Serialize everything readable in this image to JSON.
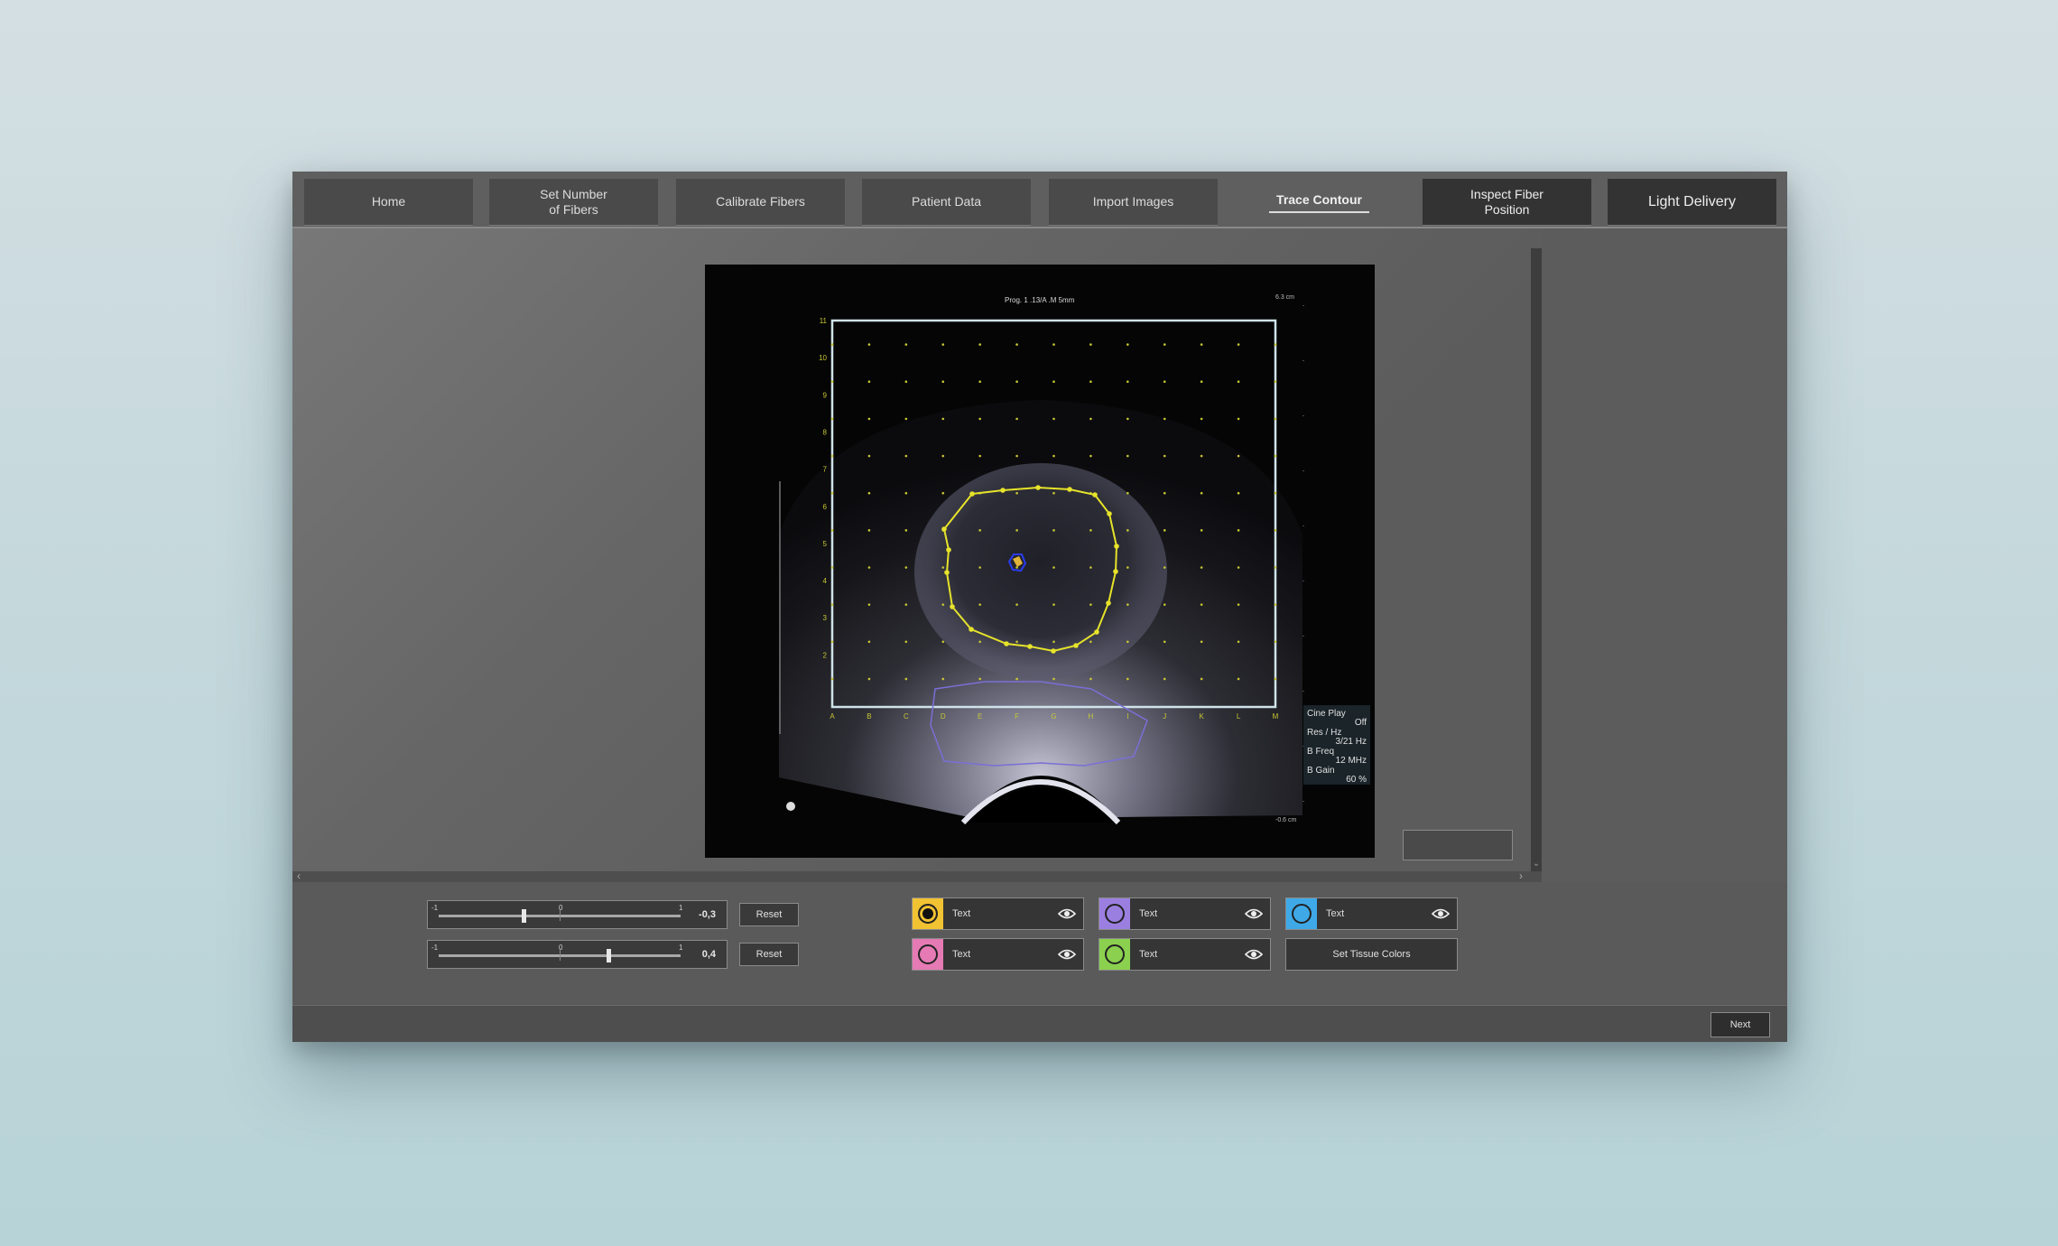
{
  "tabs": [
    {
      "label": "Home",
      "style": "normal"
    },
    {
      "label": "Set Number\nof Fibers",
      "style": "normal"
    },
    {
      "label": "Calibrate Fibers",
      "style": "normal"
    },
    {
      "label": "Patient Data",
      "style": "normal"
    },
    {
      "label": "Import Images",
      "style": "normal"
    },
    {
      "label": "Trace Contour",
      "style": "active"
    },
    {
      "label": "Inspect Fiber\nPosition",
      "style": "dark"
    },
    {
      "label": "Light Delivery",
      "style": "dark"
    }
  ],
  "image": {
    "header_text": "Prog. 1 .13/A .M 5mm",
    "depth_top": "6.3 cm",
    "depth_bottom": "-0.6 cm",
    "grid_row_labels": [
      "11",
      "10",
      "9",
      "8",
      "7",
      "6",
      "5",
      "4",
      "3",
      "2"
    ],
    "grid_col_labels": [
      "A",
      "B",
      "C",
      "D",
      "E",
      "F",
      "G",
      "H",
      "I",
      "J",
      "K",
      "L",
      "M"
    ],
    "info_panel": [
      {
        "label": "Cine Play",
        "value": "Off"
      },
      {
        "label": "Res / Hz",
        "value": "3/21 Hz"
      },
      {
        "label": "B Freq",
        "value": "12 MHz"
      },
      {
        "label": "B Gain",
        "value": "60 %"
      }
    ],
    "contour_color": "#e6e32a",
    "grid_frame_color": "#cfe3e8",
    "probe_contour_color": "#7a6fd6"
  },
  "sliders": [
    {
      "min_label": "-1",
      "mid_label": "0",
      "max_label": "1",
      "value_text": "-0,3",
      "value": -0.3
    },
    {
      "min_label": "-1",
      "mid_label": "0",
      "max_label": "1",
      "value_text": "0,4",
      "value": 0.4
    }
  ],
  "reset_label": "Reset",
  "tissues": [
    {
      "label": "Text",
      "color": "#f1c232",
      "icon": "eye-icon",
      "selected": true
    },
    {
      "label": "Text",
      "color": "#9b7fe0",
      "icon": "eye-icon"
    },
    {
      "label": "Text",
      "color": "#3fa9e8",
      "icon": "eye-icon"
    },
    {
      "label": "Text",
      "color": "#e57ab4",
      "icon": "eye-icon"
    },
    {
      "label": "Text",
      "color": "#8bd14f",
      "icon": "eye-icon"
    }
  ],
  "set_tissue_colors_label": "Set Tissue Colors",
  "next_label": "Next"
}
